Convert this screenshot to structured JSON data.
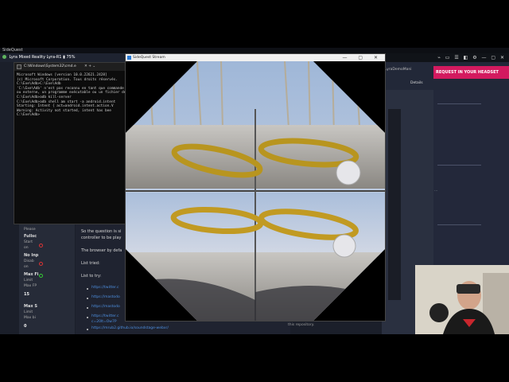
{
  "app_bar": {
    "title": "SideQuest"
  },
  "lyra_bar": {
    "label": "Lyra Mixed Reality Lyra-R1",
    "battery": "75%"
  },
  "cmd": {
    "tab_title": "C:\\Windows\\System32\\cmd.e",
    "lines": [
      "Microsoft Windows [version 10.0.22621.2428]",
      "(c) Microsoft Corporation. Tous droits réservés.",
      "",
      "C:\\Exe\\Adb>C:\\Exe\\Adb",
      "'C:\\Exe\\Adb' n'est pas reconnu en tant que commande interne",
      "ou externe, un programme exécutable ou un fichier de commandes.",
      "",
      "C:\\Exe\\Adb>adb kill-server",
      "",
      "C:\\Exe\\Adb>adb shell am start -a android.intent",
      "Starting: Intent { act=android.intent.action.V",
      "Warning: Activity not started, intent has bee",
      "",
      "C:\\Exe\\Adb>"
    ]
  },
  "stream": {
    "title": "SideQuest Stream"
  },
  "browser": {
    "request_banner": "REQUEST IN YOUR HEADSET",
    "repo_name": "LyraDemoMani",
    "details_link": "Details"
  },
  "settings": {
    "labels": [
      "Please",
      "Fullsc",
      "Start",
      "on",
      "No Inp",
      "Disab",
      "on",
      "Max Fi",
      "Limit",
      "Max FP",
      "15",
      "Max S",
      "Limit",
      "Max bi",
      "0"
    ]
  },
  "gh_page": {
    "para1": "So the question is si",
    "para1b": "controller to be play",
    "para2": "The browser by defa",
    "list_tried": "List tried:",
    "list_to_try": "List to try:",
    "links": [
      "https://twitter.c",
      "https://mastodo",
      "https://mastodo",
      "https://twitter.c",
      "c=20lt=Ow7P",
      "https://mrub2.github.io/soundstage-webxr/"
    ],
    "repo_note": "this repository."
  }
}
